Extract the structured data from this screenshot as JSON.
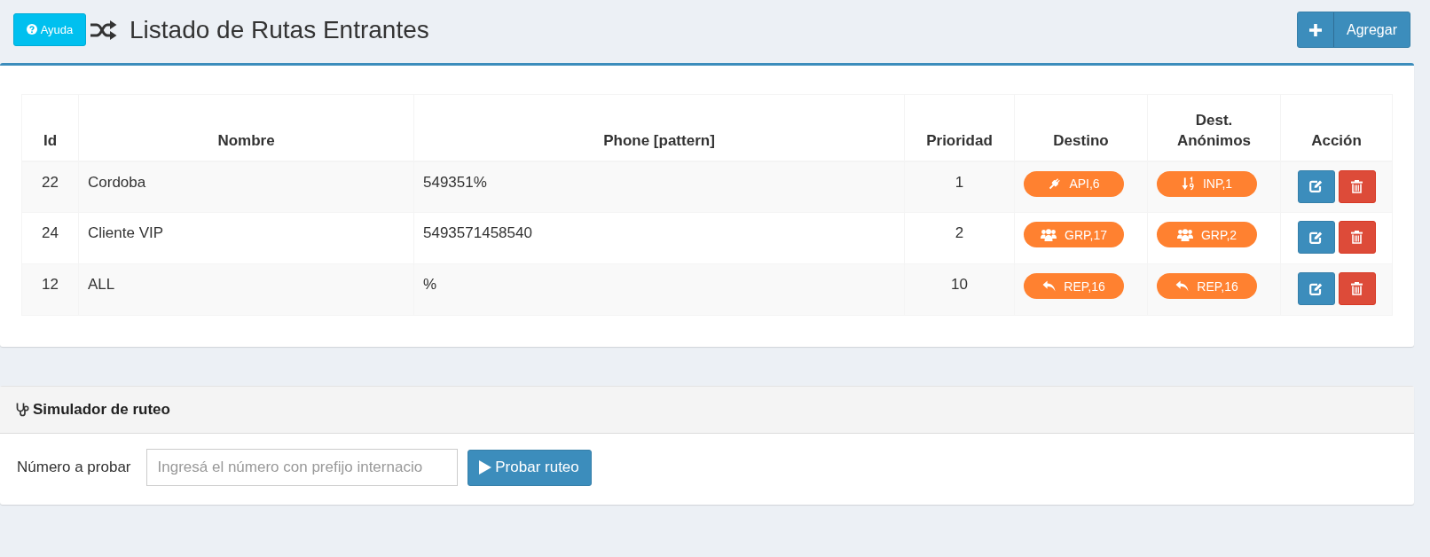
{
  "header": {
    "help_button": "Ayuda",
    "title": "Listado de Rutas Entrantes",
    "add_button": "Agregar"
  },
  "routes_table": {
    "columns": [
      "Id",
      "Nombre",
      "Phone [pattern]",
      "Prioridad",
      "Destino",
      "Dest. Anónimos",
      "Acción"
    ],
    "rows": [
      {
        "id": "22",
        "name": "Cordoba",
        "pattern": "549351%",
        "priority": "1",
        "destination": {
          "kind": "api",
          "label": "API,6"
        },
        "anonymous_destination": {
          "kind": "input",
          "label": "INP,1"
        }
      },
      {
        "id": "24",
        "name": "Cliente VIP",
        "pattern": "5493571458540",
        "priority": "2",
        "destination": {
          "kind": "group",
          "label": "GRP,17"
        },
        "anonymous_destination": {
          "kind": "group",
          "label": "GRP,2"
        }
      },
      {
        "id": "12",
        "name": "ALL",
        "pattern": "%",
        "priority": "10",
        "destination": {
          "kind": "reply",
          "label": "REP,16"
        },
        "anonymous_destination": {
          "kind": "reply",
          "label": "REP,16"
        }
      }
    ]
  },
  "simulator": {
    "title": "Simulador de ruteo",
    "label": "Número a probar",
    "input": {
      "placeholder": "Ingresá el número con prefijo internacio"
    },
    "button": "Probar ruteo"
  }
}
